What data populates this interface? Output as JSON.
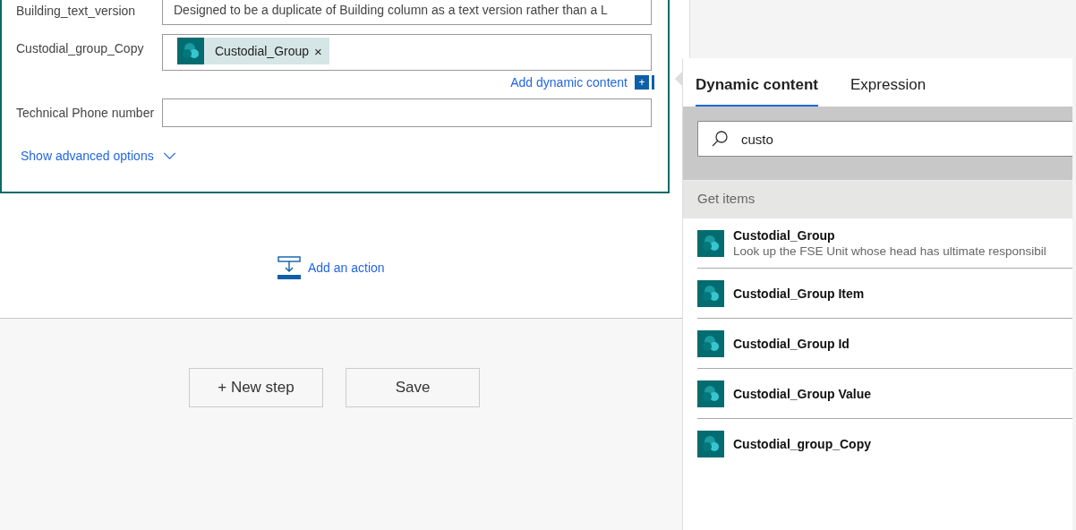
{
  "card": {
    "fields": [
      {
        "kind": "text",
        "label": "Building_text_version",
        "value": "Designed to be a duplicate of Building column as a text version rather than a L"
      },
      {
        "kind": "tokens",
        "label": "Custodial_group_Copy",
        "tokens": [
          {
            "label": "Custodial_Group",
            "remove": "×"
          }
        ]
      },
      {
        "kind": "text",
        "label": "Technical Phone number"
      }
    ],
    "add_dynamic_content": "Add dynamic content",
    "add_glyph": "+",
    "show_advanced": "Show advanced options"
  },
  "add_action": "Add an action",
  "buttons": [
    "+ New step",
    "Save"
  ],
  "panel": {
    "tabs": [
      {
        "label": "Dynamic content",
        "selected": true
      },
      {
        "label": "Expression",
        "selected": false
      }
    ],
    "search": {
      "value": "custo"
    },
    "section": "Get items",
    "items": [
      {
        "title": "Custodial_Group",
        "description": "Look up the FSE Unit whose head has ultimate responsibil"
      },
      {
        "title": "Custodial_Group Item"
      },
      {
        "title": "Custodial_Group Id"
      },
      {
        "title": "Custodial_Group Value"
      },
      {
        "title": "Custodial_group_Copy"
      }
    ]
  }
}
